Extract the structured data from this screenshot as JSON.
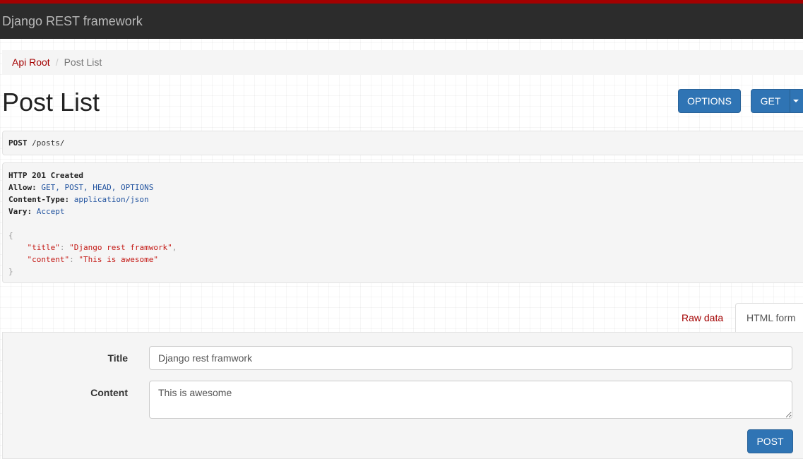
{
  "navbar": {
    "brand": "Django REST framework"
  },
  "breadcrumb": {
    "root": "Api Root",
    "separator": "/",
    "current": "Post List"
  },
  "page": {
    "title": "Post List"
  },
  "actions": {
    "options_label": "OPTIONS",
    "get_label": "GET"
  },
  "request": {
    "method": "POST",
    "path": "/posts/"
  },
  "response": {
    "status": "HTTP 201 Created",
    "headers": [
      {
        "name": "Allow:",
        "value": "GET, POST, HEAD, OPTIONS"
      },
      {
        "name": "Content-Type:",
        "value": "application/json"
      },
      {
        "name": "Vary:",
        "value": "Accept"
      }
    ],
    "body": {
      "open_brace": "{",
      "title_key": "\"title\"",
      "title_value": "\"Django rest framwork\"",
      "content_key": "\"content\"",
      "content_value": "\"This is awesome\"",
      "close_brace": "}"
    }
  },
  "tabs": {
    "raw_data": "Raw data",
    "html_form": "HTML form"
  },
  "form": {
    "title_label": "Title",
    "title_value": "Django rest framwork",
    "content_label": "Content",
    "content_value": "This is awesome",
    "submit_label": "POST"
  },
  "colors": {
    "brand_red": "#a30000",
    "navbar_bg": "#2c2c2c",
    "primary_button": "#2f74b4"
  }
}
